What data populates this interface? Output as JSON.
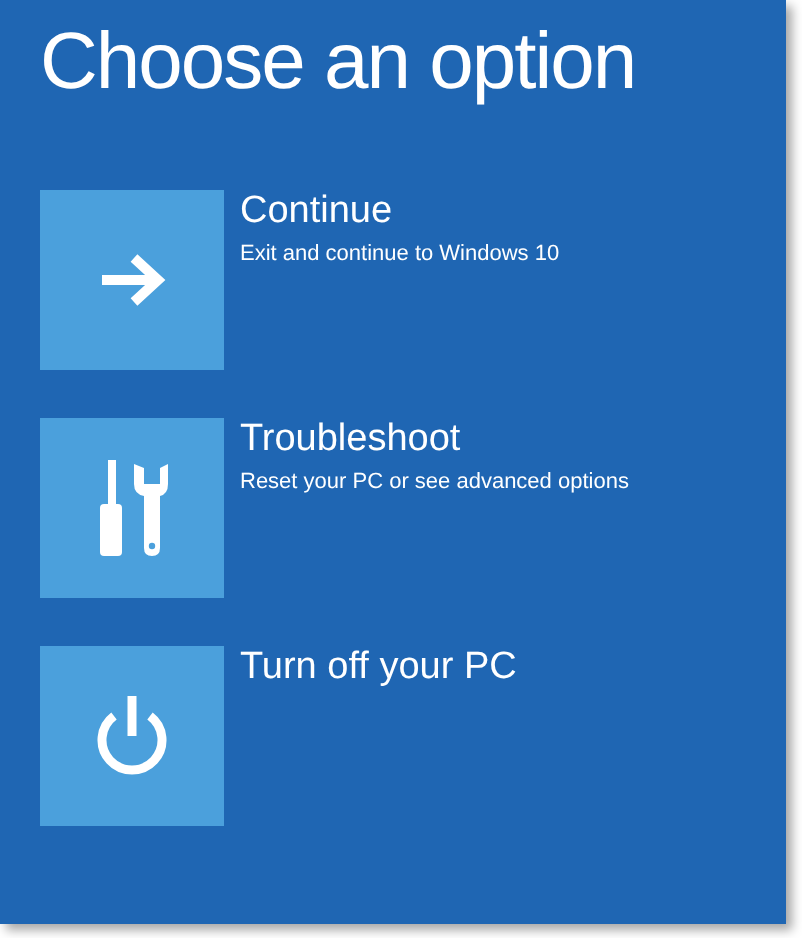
{
  "title": "Choose an option",
  "options": [
    {
      "kind": "arrow",
      "label": "Continue",
      "description": "Exit and continue to Windows 10"
    },
    {
      "kind": "tools",
      "label": "Troubleshoot",
      "description": "Reset your PC or see advanced options"
    },
    {
      "kind": "power",
      "label": "Turn off your PC"
    }
  ]
}
